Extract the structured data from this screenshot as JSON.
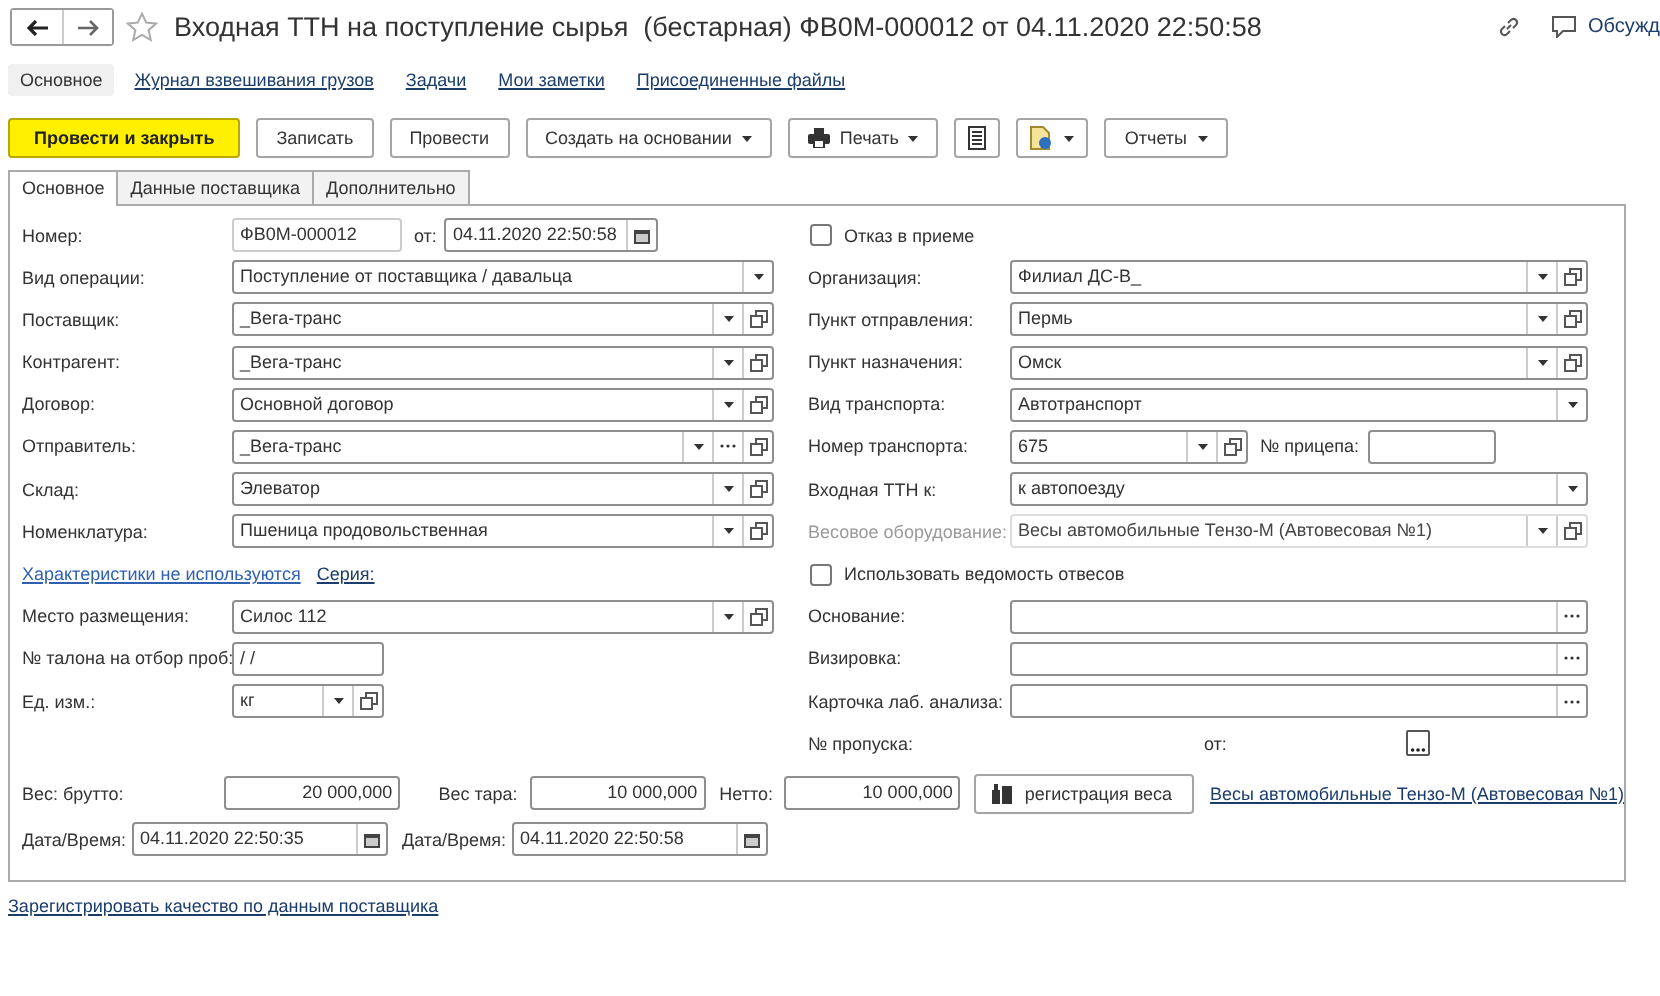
{
  "title_bar": {
    "title": "Входная ТТН на поступление сырья  (бестарная) ФВ0М-000012 от 04.11.2020 22:50:58",
    "discuss": "Обсужд"
  },
  "sections": [
    {
      "label": "Основное",
      "selected": true
    },
    {
      "label": "Журнал взвешивания грузов",
      "selected": false
    },
    {
      "label": "Задачи",
      "selected": false
    },
    {
      "label": "Мои заметки",
      "selected": false
    },
    {
      "label": "Присоединенные файлы",
      "selected": false
    }
  ],
  "toolbar": [
    {
      "kind": "primary",
      "label": "Провести и закрыть"
    },
    {
      "kind": "button",
      "label": "Записать"
    },
    {
      "kind": "button",
      "label": "Провести"
    },
    {
      "kind": "menu",
      "label": "Создать на основании"
    },
    {
      "kind": "print",
      "label": "Печать"
    },
    {
      "kind": "list"
    },
    {
      "kind": "docmenu"
    },
    {
      "kind": "menu",
      "label": "Отчеты"
    }
  ],
  "tabs": [
    {
      "label": "Основное",
      "selected": true
    },
    {
      "label": "Данные поставщика",
      "selected": false
    },
    {
      "label": "Дополнительно",
      "selected": false
    }
  ],
  "left": [
    {
      "kind": "number",
      "label": "Номер:",
      "value": "ФВ0М-000012",
      "date_label": "от:",
      "date_value": "04.11.2020 22:50:58"
    },
    {
      "kind": "field",
      "label": "Вид операции:",
      "value": "Поступление от поставщика / давальца",
      "dropdown": true,
      "select": false,
      "open": false,
      "disabled": false
    },
    {
      "kind": "field",
      "label": "Поставщик:",
      "value": "_Вега-транс",
      "dropdown": true,
      "select": false,
      "open": true,
      "disabled": false
    },
    {
      "kind": "field",
      "label": "Контрагент:",
      "value": "_Вега-транс",
      "dropdown": true,
      "select": false,
      "open": true,
      "disabled": false
    },
    {
      "kind": "field",
      "label": "Договор:",
      "value": "Основной договор",
      "dropdown": true,
      "select": false,
      "open": true,
      "disabled": false
    },
    {
      "kind": "field",
      "label": "Отправитель:",
      "value": "_Вега-транс",
      "dropdown": true,
      "select": true,
      "open": true,
      "disabled": false
    },
    {
      "kind": "field",
      "label": "Склад:",
      "value": "Элеватор",
      "dropdown": true,
      "select": false,
      "open": true,
      "disabled": false
    },
    {
      "kind": "field",
      "label": "Номенклатура:",
      "value": "Пшеница продовольственная",
      "dropdown": true,
      "select": false,
      "open": true,
      "disabled": false
    },
    {
      "kind": "links",
      "items": [
        "Характеристики не используются",
        "Серия:"
      ]
    },
    {
      "kind": "field",
      "label": "Место размещения:",
      "value": "Силос 112",
      "dropdown": true,
      "select": false,
      "open": true,
      "disabled": false
    },
    {
      "kind": "short",
      "label": "№ талона на отбор проб:",
      "value": "/ /",
      "dropdown": false,
      "select": false,
      "open": false,
      "disabled": false
    },
    {
      "kind": "short",
      "label": "Ед. изм.:",
      "value": "кг",
      "dropdown": true,
      "select": false,
      "open": true,
      "disabled": false
    }
  ],
  "right": [
    {
      "kind": "checkbox",
      "label": "Отказ в приеме",
      "checked": false
    },
    {
      "kind": "field",
      "label": "Организация:",
      "value": "Филиал ДС-В_",
      "dropdown": true,
      "select": false,
      "open": true,
      "disabled": false
    },
    {
      "kind": "field",
      "label": "Пункт отправления:",
      "value": "Пермь",
      "dropdown": true,
      "select": false,
      "open": true,
      "disabled": false
    },
    {
      "kind": "field",
      "label": "Пункт назначения:",
      "value": "Омск",
      "dropdown": true,
      "select": false,
      "open": true,
      "disabled": false
    },
    {
      "kind": "field",
      "label": "Вид транспорта:",
      "value": "Автотранспорт",
      "dropdown": true,
      "select": false,
      "open": false,
      "disabled": false
    },
    {
      "kind": "transport",
      "label": "Номер транспорта:",
      "value": "675",
      "dropdown": true,
      "select": false,
      "open": true,
      "trailer_label": "№ прицепа:",
      "disabled": false
    },
    {
      "kind": "field",
      "label": "Входная ТТН к:",
      "value": "к автопоезду",
      "dropdown": true,
      "select": false,
      "open": false,
      "disabled": false
    },
    {
      "kind": "field",
      "label": "Весовое оборудование:",
      "value": "Весы автомобильные Тензо-М (Автовесовая №1)",
      "dropdown": true,
      "select": false,
      "open": true,
      "disabled": true
    },
    {
      "kind": "checkbox",
      "label": "Использовать ведомость отвесов",
      "checked": false
    },
    {
      "kind": "field",
      "label": "Основание:",
      "dropdown": false,
      "select": true,
      "open": false,
      "disabled": false
    },
    {
      "kind": "field",
      "label": "Визировка:",
      "dropdown": false,
      "select": true,
      "open": false,
      "disabled": false
    },
    {
      "kind": "field",
      "label": "Карточка лаб.  анализа:",
      "dropdown": false,
      "select": true,
      "open": false,
      "disabled": false
    },
    {
      "kind": "pass",
      "label": "№ пропуска:",
      "date_label": "от:"
    }
  ],
  "weights": [
    {
      "label": "Вес: брутто:",
      "value": "20 000,000"
    },
    {
      "label": "Вес тара:",
      "value": "10 000,000"
    },
    {
      "label": "Нетто:",
      "value": "10 000,000"
    }
  ],
  "weigh_button": "регистрация веса",
  "scales_link": "Весы автомобильные Тензо-М (Автовесовая №1)",
  "dates": [
    {
      "label": "Дата/Время:",
      "value": "04.11.2020 22:50:35"
    },
    {
      "label": "Дата/Время:",
      "value": "04.11.2020 22:50:58"
    }
  ],
  "footer_link": "Зарегистрировать качество по данным поставщика"
}
